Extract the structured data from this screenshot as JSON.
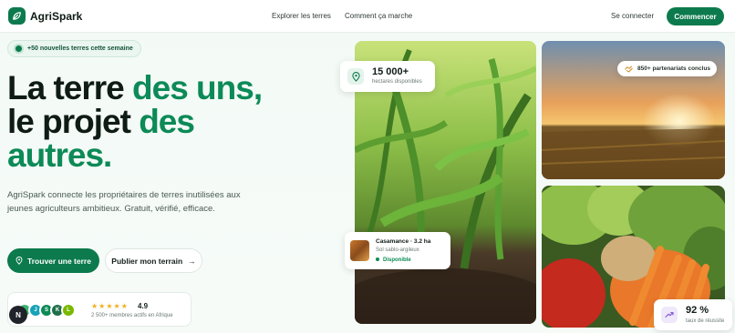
{
  "header": {
    "brand": "AgriSpark",
    "nav": [
      "Explorer les terres",
      "Comment ça marche"
    ],
    "login": "Se connecter",
    "cta": "Commencer"
  },
  "hero": {
    "pill": "+50 nouvelles terres cette semaine",
    "title_line1_a": "La terre ",
    "title_line1_b": "des uns,",
    "title_line2_a": "le projet ",
    "title_line2_b": "des",
    "title_line3": "autres.",
    "lead": "AgriSpark connecte les propriétaires de terres inutilisées aux jeunes agriculteurs ambitieux. Gratuit, vérifié, efficace.",
    "primary_button": "Trouver une terre",
    "secondary_button": "Publier mon terrain",
    "secondary_arrow": "→"
  },
  "social_proof": {
    "avatars": [
      {
        "letter": "",
        "color": "#3cb371"
      },
      {
        "letter": "J",
        "color": "#17a2b8"
      },
      {
        "letter": "S",
        "color": "#0c8a57"
      },
      {
        "letter": "K",
        "color": "#1f6f4a"
      },
      {
        "letter": "L",
        "color": "#7ab800"
      }
    ],
    "stars": "★★★★★",
    "rating": "4.9",
    "members": "2 500+ membres actifs en Afrique",
    "badge": "N"
  },
  "cards": {
    "stat_value": "15 000+",
    "stat_label": "hectares disponibles",
    "partners": "850+ partenariats conclus",
    "plot_title": "Casamance · 3.2 ha",
    "plot_soil": "Sol sablo-argileux",
    "plot_status": "Disponible",
    "rate_value": "92 %",
    "rate_label": "taux de réussite"
  },
  "colors": {
    "brand": "#0c7a4d",
    "accent": "#0c8a57",
    "star": "#f2b01e"
  },
  "icons": [
    "leaf-icon",
    "pin-icon",
    "handshake-icon",
    "trend-up-icon",
    "arrow-right-icon"
  ]
}
